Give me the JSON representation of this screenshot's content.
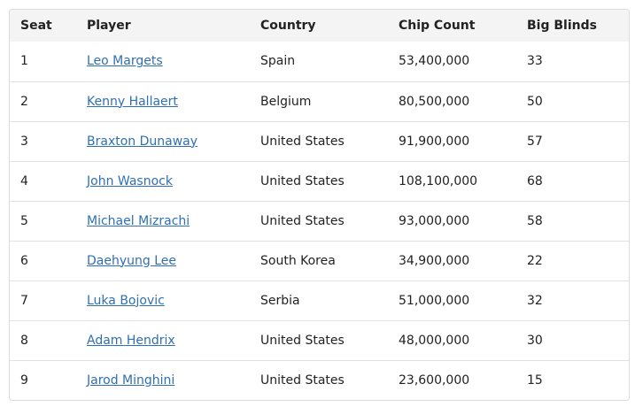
{
  "table": {
    "headers": {
      "seat": "Seat",
      "player": "Player",
      "country": "Country",
      "chip_count": "Chip Count",
      "big_blinds": "Big Blinds"
    },
    "rows": [
      {
        "seat": "1",
        "player": "Leo Margets",
        "country": "Spain",
        "chip_count": "53,400,000",
        "big_blinds": "33"
      },
      {
        "seat": "2",
        "player": "Kenny Hallaert",
        "country": "Belgium",
        "chip_count": "80,500,000",
        "big_blinds": "50"
      },
      {
        "seat": "3",
        "player": "Braxton Dunaway",
        "country": "United States",
        "chip_count": "91,900,000",
        "big_blinds": "57"
      },
      {
        "seat": "4",
        "player": "John Wasnock",
        "country": "United States",
        "chip_count": "108,100,000",
        "big_blinds": "68"
      },
      {
        "seat": "5",
        "player": "Michael Mizrachi",
        "country": "United States",
        "chip_count": "93,000,000",
        "big_blinds": "58"
      },
      {
        "seat": "6",
        "player": "Daehyung Lee",
        "country": "South Korea",
        "chip_count": "34,900,000",
        "big_blinds": "22"
      },
      {
        "seat": "7",
        "player": "Luka Bojovic",
        "country": "Serbia",
        "chip_count": "51,000,000",
        "big_blinds": "32"
      },
      {
        "seat": "8",
        "player": "Adam Hendrix",
        "country": "United States",
        "chip_count": "48,000,000",
        "big_blinds": "30"
      },
      {
        "seat": "9",
        "player": "Jarod Minghini",
        "country": "United States",
        "chip_count": "23,600,000",
        "big_blinds": "15"
      }
    ]
  },
  "colors": {
    "link": "#2f6fb3",
    "header_bg": "#f4f4f4",
    "border": "#dcdcdc"
  }
}
